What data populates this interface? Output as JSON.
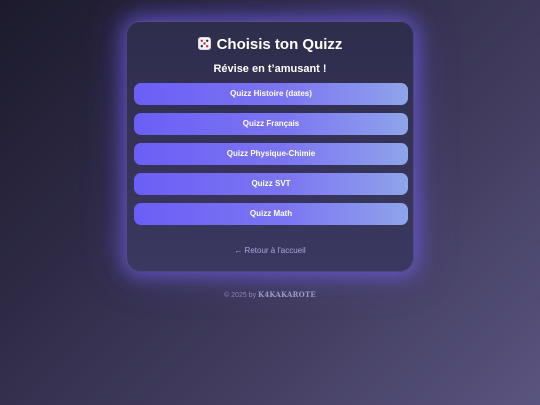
{
  "header": {
    "icon": "dice-icon",
    "title": "Choisis ton Quizz",
    "subtitle": "Révise en t’amusant !"
  },
  "quizzes": [
    {
      "label": "Quizz Histoire (dates)"
    },
    {
      "label": "Quizz Français"
    },
    {
      "label": "Quizz Physique-Chimie"
    },
    {
      "label": "Quizz SVT"
    },
    {
      "label": "Quizz Math"
    }
  ],
  "back_link": {
    "label": "← Retour à l'accueil"
  },
  "footer": {
    "copyright": "© 2025 by",
    "author": "K4KAKAROTE"
  },
  "colors": {
    "accent": "#6b5ef6",
    "accent_end": "#8fa4ea",
    "card_glow": "#7864ff"
  }
}
